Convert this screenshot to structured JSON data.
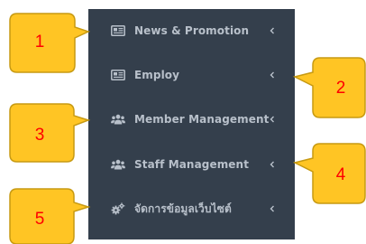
{
  "menu": {
    "items": [
      {
        "label": "News & Promotion",
        "icon": "newspaper-icon",
        "chevron": "chevron-left-icon"
      },
      {
        "label": "Employ",
        "icon": "newspaper-icon",
        "chevron": "chevron-left-icon"
      },
      {
        "label": "Member Management",
        "icon": "users-icon",
        "chevron": "chevron-left-icon"
      },
      {
        "label": "Staff Management",
        "icon": "users-icon",
        "chevron": "chevron-left-icon"
      },
      {
        "label": "จัดการข้อมูลเว็บไซต์",
        "icon": "cogs-icon",
        "chevron": "chevron-left-icon"
      }
    ]
  },
  "callouts": {
    "c1": "1",
    "c2": "2",
    "c3": "3",
    "c4": "4",
    "c5": "5"
  },
  "colors": {
    "sidebar_bg": "#343f4c",
    "menu_text": "#b8c0ca",
    "callout_fill": "#ffc524",
    "callout_stroke": "#c79a12",
    "callout_text": "#ff0000"
  }
}
